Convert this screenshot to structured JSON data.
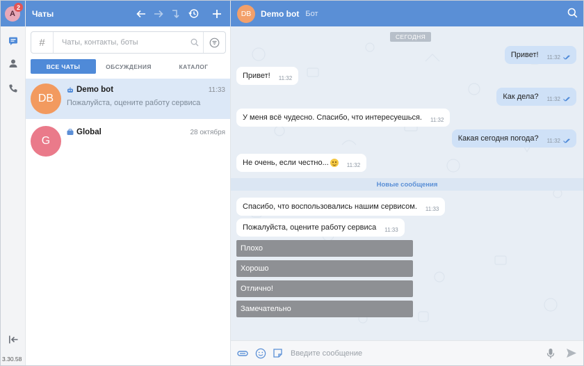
{
  "rail": {
    "avatar_letter": "A",
    "badge_count": "2",
    "version": "3.30.58"
  },
  "list": {
    "title": "Чаты",
    "search_placeholder": "Чаты, контакты, боты",
    "hash_symbol": "#",
    "tabs": [
      {
        "label": "ВСЕ ЧАТЫ",
        "active": true
      },
      {
        "label": "ОБСУЖДЕНИЯ",
        "active": false
      },
      {
        "label": "КАТАЛОГ",
        "active": false
      }
    ],
    "chats": [
      {
        "initials": "DB",
        "name": "Demo bot",
        "time": "11:33",
        "preview": "Пожалуйста, оцените работу сервиса",
        "type_icon": "bot-icon",
        "avatar_color": "#f29a5f",
        "selected": true
      },
      {
        "initials": "G",
        "name": "Global",
        "time": "28 октября",
        "preview": "",
        "type_icon": "channel-icon",
        "avatar_color": "#ea7a8a",
        "selected": false
      }
    ]
  },
  "conversation": {
    "avatar_initials": "DB",
    "name": "Demo bot",
    "subtitle": "Бот",
    "date_chip": "СЕГОДНЯ",
    "new_messages_label": "Новые сообщения",
    "messages": [
      {
        "dir": "out",
        "text": "Привет!",
        "time": "11:32"
      },
      {
        "dir": "in",
        "text": "Привет!",
        "time": "11:32"
      },
      {
        "dir": "out",
        "text": "Как дела?",
        "time": "11:32"
      },
      {
        "dir": "in",
        "text": "У меня всё чудесно. Спасибо, что интересуешься.",
        "time": "11:32"
      },
      {
        "dir": "out",
        "text": "Какая сегодня погода?",
        "time": "11:32"
      },
      {
        "dir": "in",
        "text": "Не очень, если честно...",
        "time": "11:32"
      },
      {
        "dir": "in",
        "text": "Спасибо, что воспользовались нашим сервисом.",
        "time": "11:33"
      },
      {
        "dir": "in",
        "text": "Пожалуйста, оцените работу сервиса",
        "time": "11:33"
      }
    ],
    "quick_replies": [
      "Плохо",
      "Хорошо",
      "Отлично!",
      "Замечательно"
    ],
    "composer_placeholder": "Введите сообщение"
  },
  "colors": {
    "header": "#5a8fd6",
    "selected_chat": "#dce8f7",
    "outgoing_bubble": "#cfe1f7",
    "quick_reply": "#8e9094",
    "badge": "#e25555"
  }
}
